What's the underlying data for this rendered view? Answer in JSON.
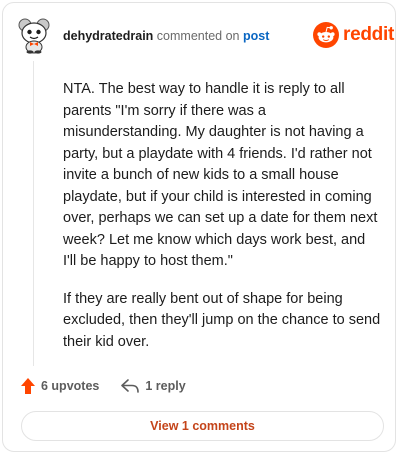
{
  "comment": {
    "username": "dehydratedrain",
    "commented_on": "commented on",
    "post_link": "post",
    "paragraphs": [
      "NTA. The best way to handle it is reply to all parents \"I'm sorry if there was a misunderstanding. My daughter is not having a party, but a playdate with 4 friends. I'd rather not invite a bunch of new kids to a small house playdate, but if your child is interested in coming over, perhaps we can set up a date for them next week? Let me know which days work best, and I'll be happy to host them.\"",
      "If they are really bent out of shape for being excluded, then they'll jump on the chance to send their kid over."
    ]
  },
  "brand": {
    "wordmark": "reddit",
    "color": "#ff4500"
  },
  "actions": {
    "upvotes": "6 upvotes",
    "reply": "1 reply"
  },
  "view_button": {
    "label": "View 1 comments"
  },
  "icons": {
    "avatar": "snoo-avatar-icon",
    "logo": "reddit-logo-icon",
    "upvote": "upvote-arrow-icon",
    "reply": "reply-arrow-icon"
  },
  "colors": {
    "accent": "#ff4500",
    "link": "#0a66c2",
    "button_text": "#c4441a"
  }
}
